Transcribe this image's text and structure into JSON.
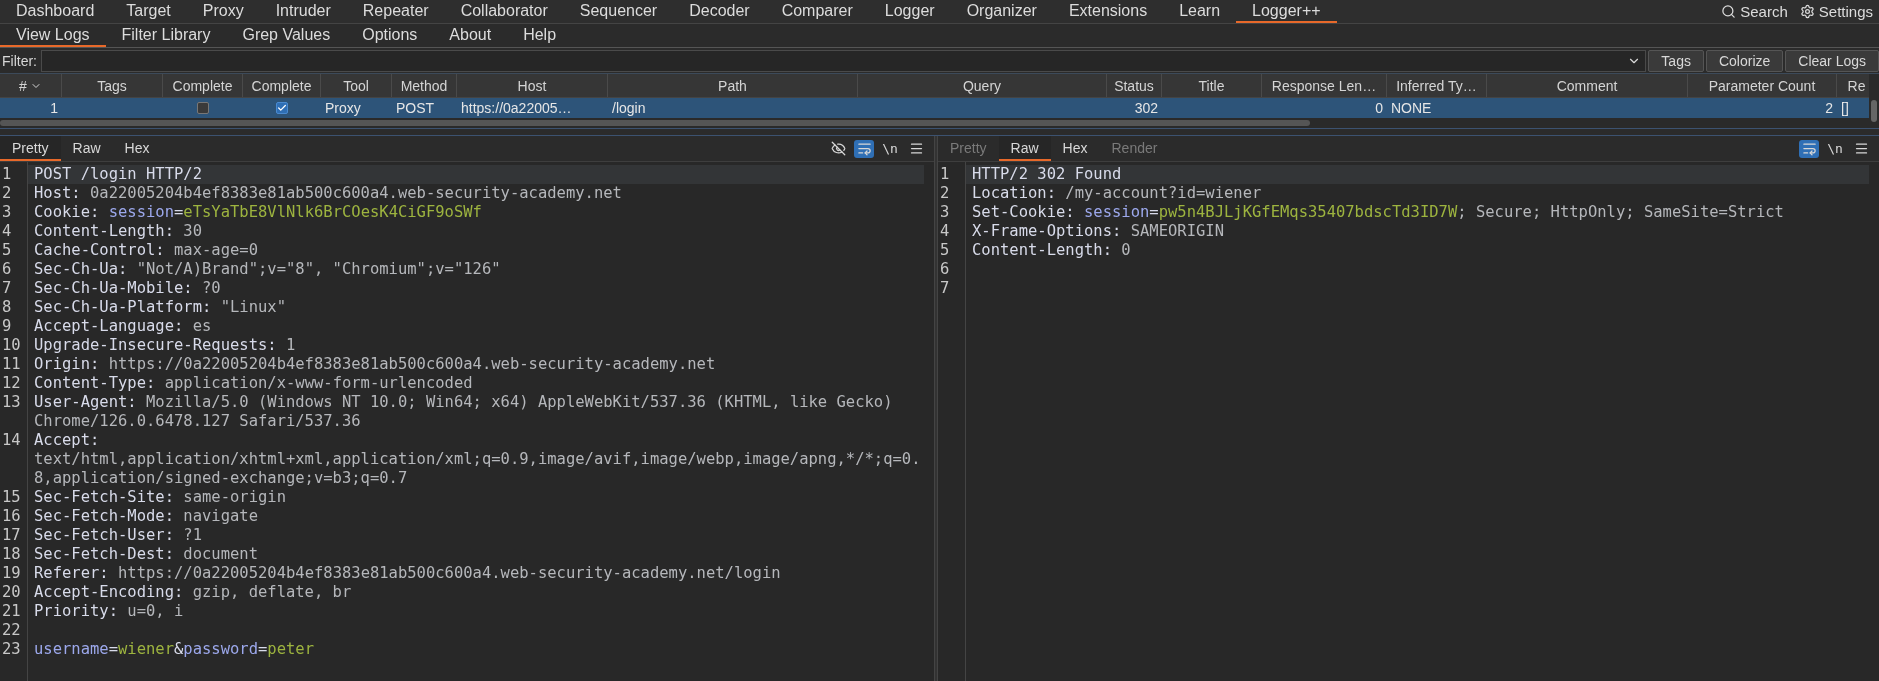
{
  "menu_bar": {
    "tabs": [
      {
        "label": "Dashboard",
        "selected": false
      },
      {
        "label": "Target",
        "selected": false
      },
      {
        "label": "Proxy",
        "selected": false
      },
      {
        "label": "Intruder",
        "selected": false
      },
      {
        "label": "Repeater",
        "selected": false
      },
      {
        "label": "Collaborator",
        "selected": false
      },
      {
        "label": "Sequencer",
        "selected": false
      },
      {
        "label": "Decoder",
        "selected": false
      },
      {
        "label": "Comparer",
        "selected": false
      },
      {
        "label": "Logger",
        "selected": false
      },
      {
        "label": "Organizer",
        "selected": false
      },
      {
        "label": "Extensions",
        "selected": false
      },
      {
        "label": "Learn",
        "selected": false
      },
      {
        "label": "Logger++",
        "selected": true
      }
    ],
    "search": "Search",
    "settings": "Settings"
  },
  "logger_tabs": [
    {
      "label": "View Logs",
      "selected": true
    },
    {
      "label": "Filter Library",
      "selected": false
    },
    {
      "label": "Grep Values",
      "selected": false
    },
    {
      "label": "Options",
      "selected": false
    },
    {
      "label": "About",
      "selected": false
    },
    {
      "label": "Help",
      "selected": false
    }
  ],
  "filter": {
    "label": "Filter:",
    "buttons": [
      "Tags",
      "Colorize",
      "Clear Logs"
    ]
  },
  "table": {
    "columns": [
      {
        "label": "#",
        "sorted": true
      },
      {
        "label": "Tags",
        "sorted": false
      },
      {
        "label": "Complete",
        "sorted": false
      },
      {
        "label": "Complete",
        "sorted": false
      },
      {
        "label": "Tool",
        "sorted": false
      },
      {
        "label": "Method",
        "sorted": false
      },
      {
        "label": "Host",
        "sorted": false
      },
      {
        "label": "Path",
        "sorted": false
      },
      {
        "label": "Query",
        "sorted": false
      },
      {
        "label": "Status",
        "sorted": false
      },
      {
        "label": "Title",
        "sorted": false
      },
      {
        "label": "Response Len…",
        "sorted": false
      },
      {
        "label": "Inferred Ty…",
        "sorted": false
      },
      {
        "label": "Comment",
        "sorted": false
      },
      {
        "label": "Parameter Count",
        "sorted": false
      },
      {
        "label": "Re",
        "sorted": false
      }
    ],
    "rows": [
      {
        "selected": true,
        "cells": [
          {
            "kind": "number",
            "text": "1"
          },
          {
            "kind": "text"
          },
          {
            "kind": "checkbox",
            "checked": false
          },
          {
            "kind": "checkbox",
            "checked": true
          },
          {
            "kind": "text",
            "text": "Proxy"
          },
          {
            "kind": "text",
            "text": "POST"
          },
          {
            "kind": "text",
            "text": "https://0a22005…"
          },
          {
            "kind": "text",
            "text": "/login"
          },
          {
            "kind": "text"
          },
          {
            "kind": "number",
            "text": "302"
          },
          {
            "kind": "text"
          },
          {
            "kind": "number",
            "text": "0"
          },
          {
            "kind": "text",
            "text": "NONE"
          },
          {
            "kind": "text"
          },
          {
            "kind": "number",
            "text": "2"
          },
          {
            "kind": "text",
            "text": "[]"
          }
        ]
      }
    ]
  },
  "request": {
    "tabs": [
      {
        "label": "Pretty",
        "selected": true,
        "disabled": false
      },
      {
        "label": "Raw",
        "selected": false,
        "disabled": false
      },
      {
        "label": "Hex",
        "selected": false,
        "disabled": false
      }
    ],
    "tools": [
      {
        "kind": "eye",
        "on": false
      },
      {
        "kind": "wrap",
        "on": true
      },
      {
        "kind": "newline",
        "label": "\\n",
        "on": false
      },
      {
        "kind": "menu",
        "on": false
      }
    ],
    "lines": [
      {
        "number": "1",
        "highlighted": true,
        "segments": [
          {
            "text": "POST /login HTTP/2",
            "kind": "name"
          }
        ]
      },
      {
        "number": "2",
        "highlighted": false,
        "segments": [
          {
            "text": "Host: ",
            "kind": "name"
          },
          {
            "text": "0a22005204b4ef8383e81ab500c600a4.web-security-academy.net",
            "kind": "value"
          }
        ]
      },
      {
        "number": "3",
        "highlighted": false,
        "segments": [
          {
            "text": "Cookie: ",
            "kind": "name"
          },
          {
            "text": "session",
            "kind": "param"
          },
          {
            "text": "=",
            "kind": "name"
          },
          {
            "text": "eTsYaTbE8VlNlk6BrCOesK4CiGF9oSWf",
            "kind": "token"
          }
        ]
      },
      {
        "number": "4",
        "highlighted": false,
        "segments": [
          {
            "text": "Content-Length: ",
            "kind": "name"
          },
          {
            "text": "30",
            "kind": "value"
          }
        ]
      },
      {
        "number": "5",
        "highlighted": false,
        "segments": [
          {
            "text": "Cache-Control: ",
            "kind": "name"
          },
          {
            "text": "max-age=0",
            "kind": "value"
          }
        ]
      },
      {
        "number": "6",
        "highlighted": false,
        "segments": [
          {
            "text": "Sec-Ch-Ua: ",
            "kind": "name"
          },
          {
            "text": "\"Not/A)Brand\";v=\"8\", \"Chromium\";v=\"126\"",
            "kind": "value"
          }
        ]
      },
      {
        "number": "7",
        "highlighted": false,
        "segments": [
          {
            "text": "Sec-Ch-Ua-Mobile: ",
            "kind": "name"
          },
          {
            "text": "?0",
            "kind": "value"
          }
        ]
      },
      {
        "number": "8",
        "highlighted": false,
        "segments": [
          {
            "text": "Sec-Ch-Ua-Platform: ",
            "kind": "name"
          },
          {
            "text": "\"Linux\"",
            "kind": "value"
          }
        ]
      },
      {
        "number": "9",
        "highlighted": false,
        "segments": [
          {
            "text": "Accept-Language: ",
            "kind": "name"
          },
          {
            "text": "es",
            "kind": "value"
          }
        ]
      },
      {
        "number": "10",
        "highlighted": false,
        "segments": [
          {
            "text": "Upgrade-Insecure-Requests: ",
            "kind": "name"
          },
          {
            "text": "1",
            "kind": "value"
          }
        ]
      },
      {
        "number": "11",
        "highlighted": false,
        "segments": [
          {
            "text": "Origin: ",
            "kind": "name"
          },
          {
            "text": "https://0a22005204b4ef8383e81ab500c600a4.web-security-academy.net",
            "kind": "value"
          }
        ]
      },
      {
        "number": "12",
        "highlighted": false,
        "segments": [
          {
            "text": "Content-Type: ",
            "kind": "name"
          },
          {
            "text": "application/x-www-form-urlencoded",
            "kind": "value"
          }
        ]
      },
      {
        "number": "13",
        "highlighted": false,
        "segments": [
          {
            "text": "User-Agent: ",
            "kind": "name"
          },
          {
            "text": "Mozilla/5.0 (Windows NT 10.0; Win64; x64) AppleWebKit/537.36 (KHTML, like Gecko) Chrome/126.0.6478.127 Safari/537.36",
            "kind": "value"
          }
        ]
      },
      {
        "number": "14",
        "highlighted": false,
        "segments": [
          {
            "text": "Accept: ",
            "kind": "name"
          },
          {
            "text": "text/html,application/xhtml+xml,application/xml;q=0.9,image/avif,image/webp,image/apng,*/*;q=0.8,application/signed-exchange;v=b3;q=0.7",
            "kind": "value"
          }
        ]
      },
      {
        "number": "15",
        "highlighted": false,
        "segments": [
          {
            "text": "Sec-Fetch-Site: ",
            "kind": "name"
          },
          {
            "text": "same-origin",
            "kind": "value"
          }
        ]
      },
      {
        "number": "16",
        "highlighted": false,
        "segments": [
          {
            "text": "Sec-Fetch-Mode: ",
            "kind": "name"
          },
          {
            "text": "navigate",
            "kind": "value"
          }
        ]
      },
      {
        "number": "17",
        "highlighted": false,
        "segments": [
          {
            "text": "Sec-Fetch-User: ",
            "kind": "name"
          },
          {
            "text": "?1",
            "kind": "value"
          }
        ]
      },
      {
        "number": "18",
        "highlighted": false,
        "segments": [
          {
            "text": "Sec-Fetch-Dest: ",
            "kind": "name"
          },
          {
            "text": "document",
            "kind": "value"
          }
        ]
      },
      {
        "number": "19",
        "highlighted": false,
        "segments": [
          {
            "text": "Referer: ",
            "kind": "name"
          },
          {
            "text": "https://0a22005204b4ef8383e81ab500c600a4.web-security-academy.net/login",
            "kind": "value"
          }
        ]
      },
      {
        "number": "20",
        "highlighted": false,
        "segments": [
          {
            "text": "Accept-Encoding: ",
            "kind": "name"
          },
          {
            "text": "gzip, deflate, br",
            "kind": "value"
          }
        ]
      },
      {
        "number": "21",
        "highlighted": false,
        "segments": [
          {
            "text": "Priority: ",
            "kind": "name"
          },
          {
            "text": "u=0, i",
            "kind": "value"
          }
        ]
      },
      {
        "number": "22",
        "highlighted": false
      },
      {
        "number": "23",
        "highlighted": false,
        "segments": [
          {
            "text": "username",
            "kind": "param"
          },
          {
            "text": "=",
            "kind": "name"
          },
          {
            "text": "wiener",
            "kind": "token"
          },
          {
            "text": "&",
            "kind": "name"
          },
          {
            "text": "password",
            "kind": "param"
          },
          {
            "text": "=",
            "kind": "name"
          },
          {
            "text": "peter",
            "kind": "token"
          }
        ]
      }
    ]
  },
  "response": {
    "tabs": [
      {
        "label": "Pretty",
        "selected": false,
        "disabled": true
      },
      {
        "label": "Raw",
        "selected": true,
        "disabled": false
      },
      {
        "label": "Hex",
        "selected": false,
        "disabled": false
      },
      {
        "label": "Render",
        "selected": false,
        "disabled": true
      }
    ],
    "tools": [
      {
        "kind": "wrap",
        "on": true
      },
      {
        "kind": "newline",
        "label": "\\n",
        "on": false
      },
      {
        "kind": "menu",
        "on": false
      }
    ],
    "lines": [
      {
        "number": "1",
        "highlighted": true,
        "segments": [
          {
            "text": "HTTP/2 302 Found",
            "kind": "name"
          }
        ]
      },
      {
        "number": "2",
        "highlighted": false,
        "segments": [
          {
            "text": "Location: ",
            "kind": "name"
          },
          {
            "text": "/my-account?id=wiener",
            "kind": "value"
          }
        ]
      },
      {
        "number": "3",
        "highlighted": false,
        "segments": [
          {
            "text": "Set-Cookie: ",
            "kind": "name"
          },
          {
            "text": "session",
            "kind": "param"
          },
          {
            "text": "=",
            "kind": "name"
          },
          {
            "text": "pw5n4BJLjKGfEMqs35407bdscTd3ID7W",
            "kind": "token"
          },
          {
            "text": "; Secure; HttpOnly; SameSite=Strict",
            "kind": "value"
          }
        ]
      },
      {
        "number": "4",
        "highlighted": false,
        "segments": [
          {
            "text": "X-Frame-Options: ",
            "kind": "name"
          },
          {
            "text": "SAMEORIGIN",
            "kind": "value"
          }
        ]
      },
      {
        "number": "5",
        "highlighted": false,
        "segments": [
          {
            "text": "Content-Length: ",
            "kind": "name"
          },
          {
            "text": "0",
            "kind": "value"
          }
        ]
      },
      {
        "number": "6",
        "highlighted": false
      },
      {
        "number": "7",
        "highlighted": false
      }
    ]
  }
}
